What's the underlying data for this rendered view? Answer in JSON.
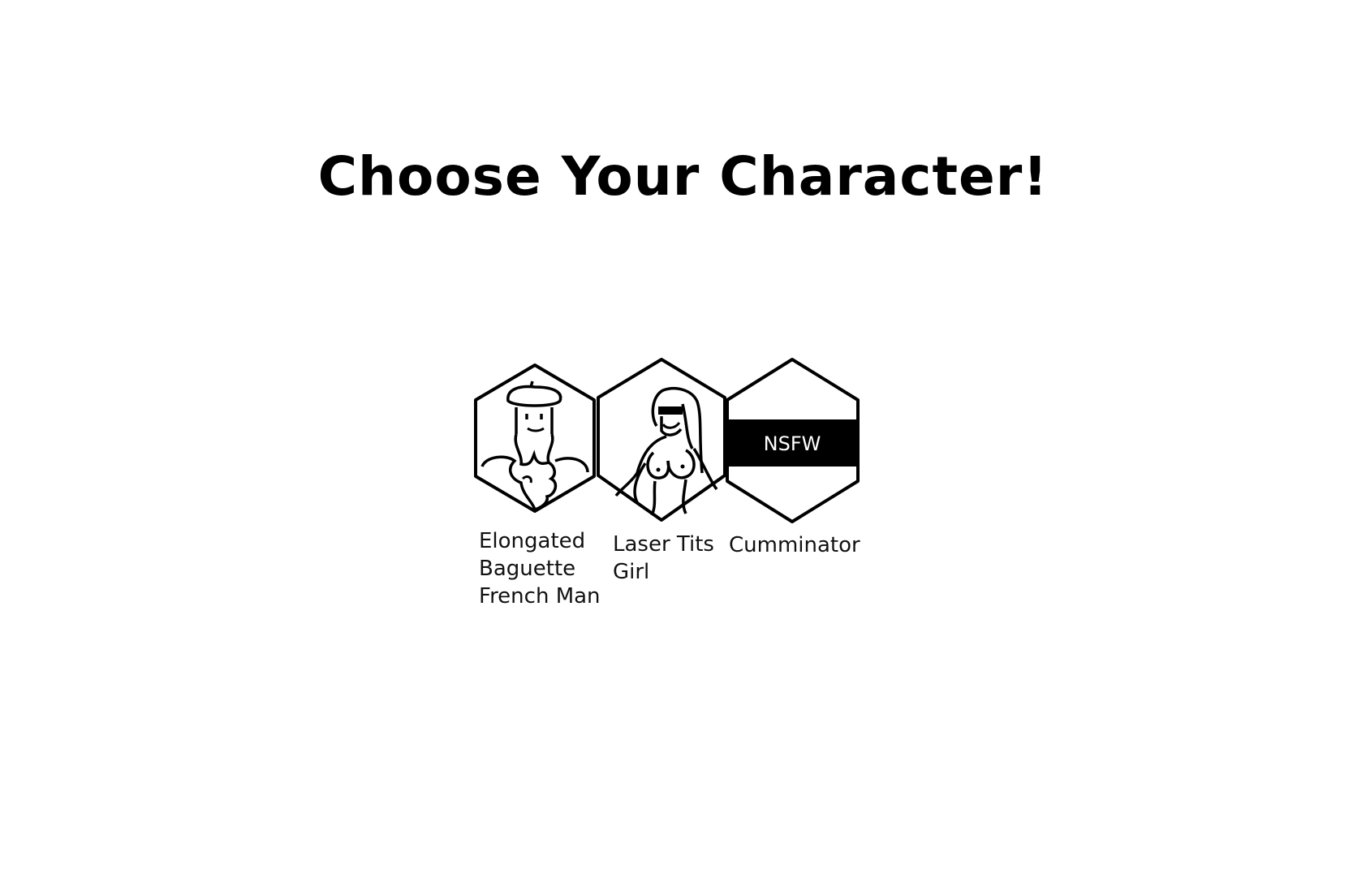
{
  "screen": {
    "title": "Choose Your Character!"
  },
  "characters": [
    {
      "label": "Elongated Baguette French Man",
      "icon": "bearded-man-beret-portrait"
    },
    {
      "label": "Laser Tits Girl",
      "icon": "girl-portrait"
    },
    {
      "label": "Cumminator",
      "icon": "censored-portrait",
      "overlay": "NSFW"
    }
  ],
  "colors": {
    "background": "#ffffff",
    "stroke": "#000000",
    "censor_bar": "#000000",
    "censor_text": "#ffffff"
  }
}
